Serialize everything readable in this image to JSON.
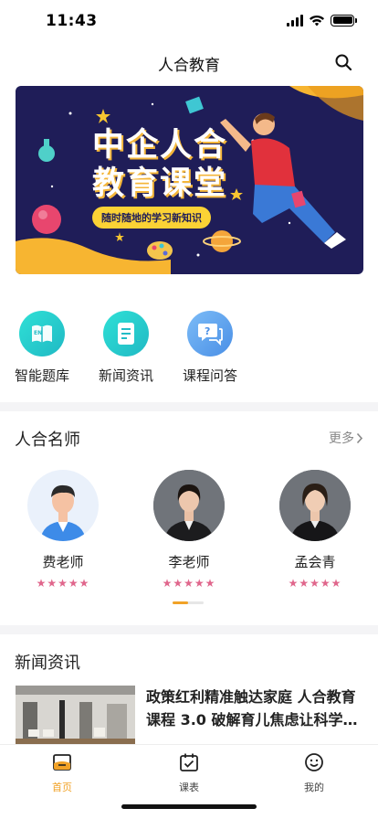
{
  "status": {
    "time": "11:43"
  },
  "nav": {
    "title": "人合教育"
  },
  "banner": {
    "line1": "中企人合",
    "line2": "教育课堂",
    "slogan": "随时随地的学习新知识"
  },
  "quick_entries": [
    {
      "label": "智能题库",
      "icon": "question-bank-icon"
    },
    {
      "label": "新闻资讯",
      "icon": "news-icon"
    },
    {
      "label": "课程问答",
      "icon": "qa-icon"
    }
  ],
  "teachers_section": {
    "title": "人合名师",
    "more": "更多",
    "teachers": [
      {
        "name": "费老师",
        "rating": 5,
        "stars": "★★★★★"
      },
      {
        "name": "李老师",
        "rating": 5,
        "stars": "★★★★★"
      },
      {
        "name": "孟会青",
        "rating": 5,
        "stars": "★★★★★"
      }
    ]
  },
  "news_section": {
    "title": "新闻资讯",
    "items": [
      {
        "title": "政策红利精准触达家庭 人合教育课程 3.0 破解育儿焦虑让科学育儿触手可及"
      }
    ]
  },
  "tabs": [
    {
      "label": "首页",
      "icon": "home-icon",
      "active": true
    },
    {
      "label": "课表",
      "icon": "calendar-check-icon",
      "active": false
    },
    {
      "label": "我的",
      "icon": "smiley-icon",
      "active": false
    }
  ],
  "colors": {
    "accent": "#f1a227",
    "star": "#e0668c",
    "banner_bg": "#1f1d58",
    "teal": "#33c6c9"
  }
}
